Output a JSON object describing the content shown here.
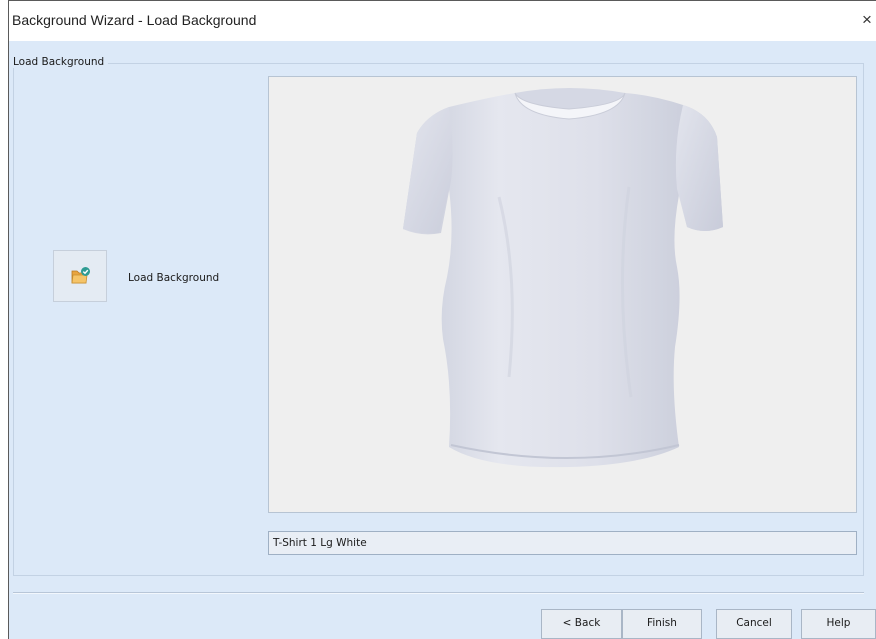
{
  "window": {
    "title": "Background Wizard - Load Background",
    "close_glyph": "×"
  },
  "group": {
    "legend": "Load Background"
  },
  "load": {
    "button_icon": "folder-image-icon",
    "label": "Load Background"
  },
  "preview": {
    "image": "white-tshirt-image"
  },
  "name_field": {
    "value": "T-Shirt 1 Lg White"
  },
  "buttons": {
    "back": "< Back",
    "finish": "Finish",
    "cancel": "Cancel",
    "help": "Help"
  },
  "colors": {
    "dialog_background": "#dce9f8",
    "preview_background": "#efefef",
    "titlebar_background": "#ffffff"
  }
}
